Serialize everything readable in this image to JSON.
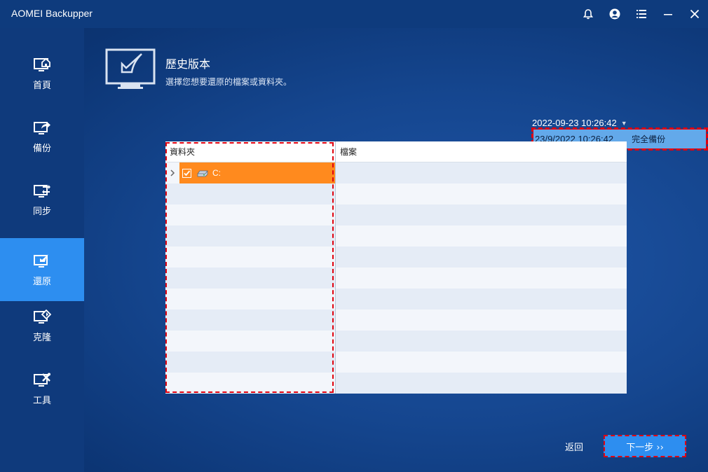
{
  "app": {
    "title": "AOMEI Backupper"
  },
  "titlebar_icons": [
    "bell-icon",
    "user-icon",
    "menu-icon",
    "minimize-icon",
    "close-icon"
  ],
  "sidebar": {
    "items": [
      {
        "label": "首頁",
        "icon": "home-icon",
        "active": false
      },
      {
        "label": "備份",
        "icon": "backup-icon",
        "active": false
      },
      {
        "label": "同步",
        "icon": "sync-icon",
        "active": false
      },
      {
        "label": "還原",
        "icon": "restore-icon",
        "active": true
      },
      {
        "label": "克隆",
        "icon": "clone-icon",
        "active": false
      },
      {
        "label": "工具",
        "icon": "tools-icon",
        "active": false
      }
    ]
  },
  "header": {
    "title": "歷史版本",
    "subtitle": "選擇您想要還原的檔案或資料夾。"
  },
  "version": {
    "selected": "2022-09-23 10:26:42",
    "option_date": "23/9/2022 10:26:42",
    "option_type": "完全備份"
  },
  "table": {
    "folder_header": "資料夾",
    "file_header": "檔案",
    "tree": [
      {
        "label": "C:",
        "checked": true
      }
    ]
  },
  "footer": {
    "back_label": "返回",
    "next_label": "下一步 ››"
  },
  "colors": {
    "accent": "#2d8ef0",
    "selection": "#ff8a1e",
    "highlight_border": "#e0000f"
  }
}
